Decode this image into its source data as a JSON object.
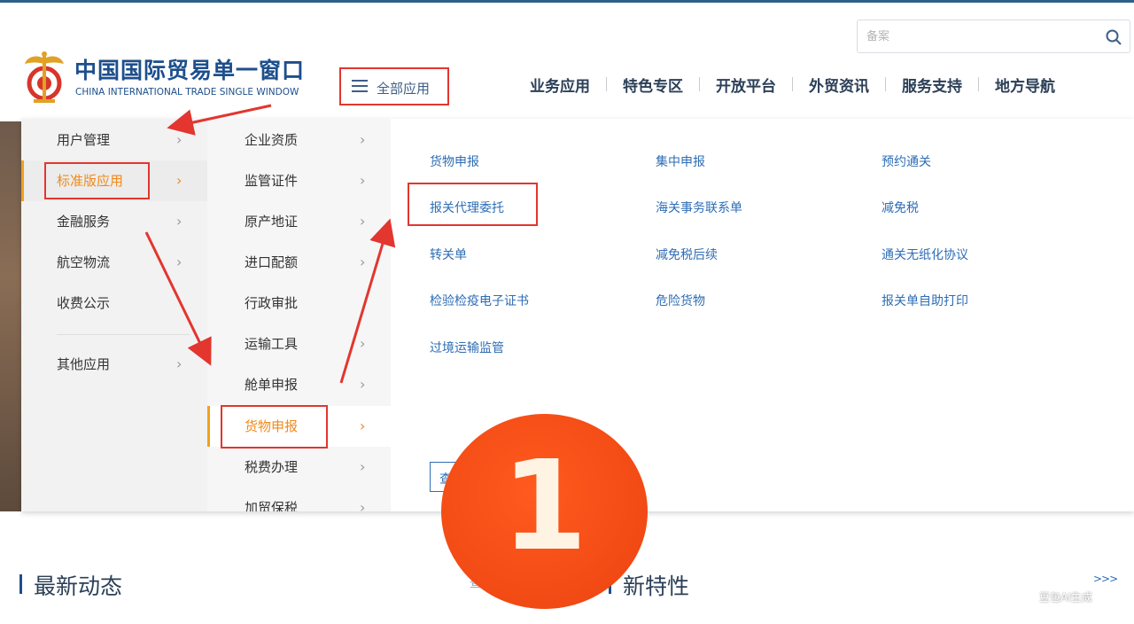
{
  "header": {
    "brand_cn": "中国国际贸易单一窗口",
    "brand_en": "CHINA INTERNATIONAL TRADE SINGLE WINDOW",
    "search_placeholder": "备案",
    "all_apps_label": "全部应用",
    "nav": [
      "业务应用",
      "特色专区",
      "开放平台",
      "外贸资讯",
      "服务支持",
      "地方导航"
    ]
  },
  "menu": {
    "level1": [
      {
        "label": "用户管理"
      },
      {
        "label": "标准版应用",
        "active": true
      },
      {
        "label": "金融服务"
      },
      {
        "label": "航空物流"
      },
      {
        "label": "收费公示"
      },
      {
        "label": "其他应用"
      }
    ],
    "level2": [
      {
        "label": "企业资质"
      },
      {
        "label": "监管证件"
      },
      {
        "label": "原产地证"
      },
      {
        "label": "进口配额"
      },
      {
        "label": "行政审批"
      },
      {
        "label": "运输工具"
      },
      {
        "label": "舱单申报"
      },
      {
        "label": "货物申报",
        "active": true
      },
      {
        "label": "税费办理"
      },
      {
        "label": "加贸保税"
      }
    ],
    "level3": [
      [
        "货物申报",
        "集中申报",
        "预约通关"
      ],
      [
        "报关代理委托",
        "海关事务联系单",
        "减免税"
      ],
      [
        "转关单",
        "减免税后续",
        "通关无纸化协议"
      ],
      [
        "检验检疫电子证书",
        "危险货物",
        "报关单自助打印"
      ],
      [
        "过境运输监管"
      ]
    ],
    "more_button": "查看全部"
  },
  "annotations": {
    "step_number": "1",
    "arrow_color": "#e2362f",
    "highlight_color": "#e2362f",
    "badge_color": "#f24a14"
  },
  "bottom": {
    "latest_news": "最新动态",
    "new_features": "新特性",
    "partial_text": "查",
    "more_arrows": ">>>",
    "watermark": "豆包AI生成"
  },
  "colors": {
    "brand": "#1d4f8c",
    "link": "#2e6db4",
    "active": "#f08a1c",
    "nav_text": "#2b3f57"
  }
}
